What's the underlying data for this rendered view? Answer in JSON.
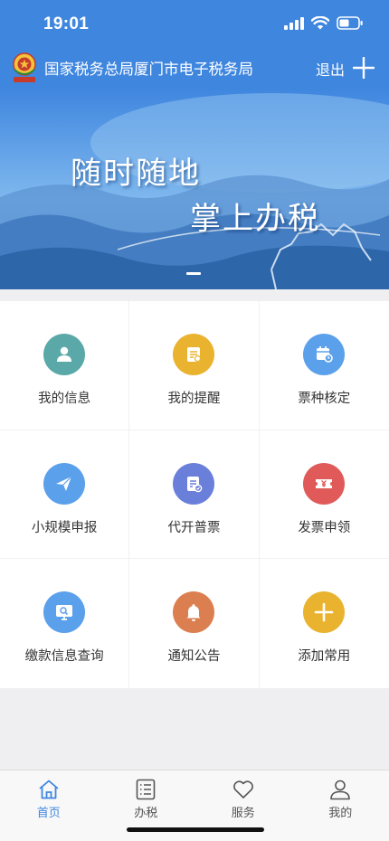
{
  "status": {
    "time": "19:01"
  },
  "header": {
    "title": "国家税务总局厦门市电子税务局",
    "logout_label": "退出"
  },
  "banner": {
    "line1": "随时随地",
    "line2": "掌上办税"
  },
  "grid": {
    "items": [
      {
        "label": "我的信息",
        "icon": "user-icon",
        "color": "#5aa9a8"
      },
      {
        "label": "我的提醒",
        "icon": "reminder-icon",
        "color": "#e9b32f"
      },
      {
        "label": "票种核定",
        "icon": "calendar-clock-icon",
        "color": "#5aa0ea"
      },
      {
        "label": "小规模申报",
        "icon": "paper-plane-icon",
        "color": "#5aa0ea"
      },
      {
        "label": "代开普票",
        "icon": "document-edit-icon",
        "color": "#6a7fd9"
      },
      {
        "label": "发票申领",
        "icon": "ticket-icon",
        "color": "#e05a5a"
      },
      {
        "label": "缴款信息查询",
        "icon": "monitor-search-icon",
        "color": "#5aa0ea"
      },
      {
        "label": "通知公告",
        "icon": "bell-icon",
        "color": "#dc7f50"
      },
      {
        "label": "添加常用",
        "icon": "plus-icon",
        "color": "#e9b32f"
      }
    ]
  },
  "tabbar": {
    "items": [
      {
        "label": "首页",
        "icon": "home-icon",
        "active": true
      },
      {
        "label": "办税",
        "icon": "list-icon",
        "active": false
      },
      {
        "label": "服务",
        "icon": "heart-icon",
        "active": false
      },
      {
        "label": "我的",
        "icon": "person-icon",
        "active": false
      }
    ],
    "active_color": "#3f86df"
  }
}
